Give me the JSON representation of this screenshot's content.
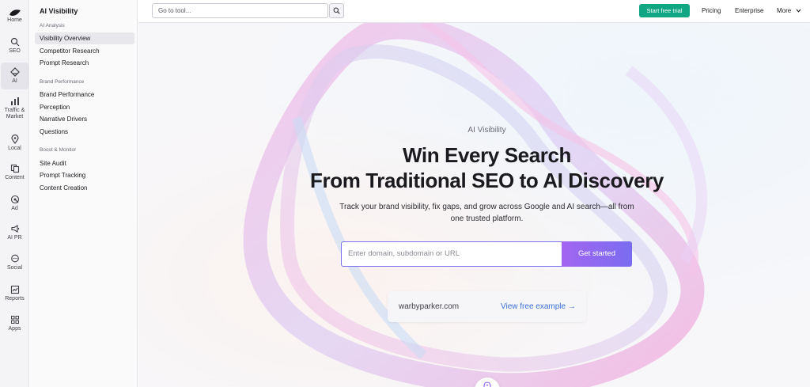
{
  "rail": {
    "items": [
      {
        "label": "Home",
        "icon": "home-logo-icon"
      },
      {
        "label": "SEO",
        "icon": "seo-icon"
      },
      {
        "label": "AI",
        "icon": "ai-icon"
      },
      {
        "label": "Traffic &",
        "label2": "Market",
        "icon": "traffic-icon"
      },
      {
        "label": "Local",
        "icon": "location-pin-icon"
      },
      {
        "label": "Content",
        "icon": "content-icon"
      },
      {
        "label": "Ad",
        "icon": "ad-icon"
      },
      {
        "label": "AI PR",
        "icon": "megaphone-icon"
      },
      {
        "label": "Social",
        "icon": "chat-icon"
      },
      {
        "label": "Reports",
        "icon": "reports-icon"
      },
      {
        "label": "Apps",
        "icon": "apps-grid-icon"
      }
    ]
  },
  "sidebar": {
    "title": "AI Visibility",
    "groups": [
      {
        "heading": "AI Analysis",
        "links": [
          "Visibility Overview",
          "Competitor Research",
          "Prompt Research"
        ]
      },
      {
        "heading": "Brand Performance",
        "links": [
          "Brand Performance",
          "Perception",
          "Narrative Drivers",
          "Questions"
        ]
      },
      {
        "heading": "Boost & Monitor",
        "links": [
          "Site Audit",
          "Prompt Tracking",
          "Content Creation"
        ]
      }
    ],
    "active_link": "Visibility Overview"
  },
  "topbar": {
    "search_placeholder": "Go to tool...",
    "trial_label": "Start free trial",
    "pricing_label": "Pricing",
    "enterprise_label": "Enterprise",
    "more_label": "More",
    "accent": "#11a683"
  },
  "hero": {
    "eyebrow": "AI Visibility",
    "headline_line1": "Win Every Search",
    "headline_line2": "From Traditional SEO to AI Discovery",
    "subtitle": "Track your brand visibility, fix gaps, and grow across Google and AI search—all from one trusted platform.",
    "input_placeholder": "Enter domain, subdomain or URL",
    "cta_label": "Get started",
    "example_domain": "warbyparker.com",
    "example_link": "View free example →",
    "cta_color_start": "#a266f2",
    "cta_color_end": "#7a6cf0"
  }
}
